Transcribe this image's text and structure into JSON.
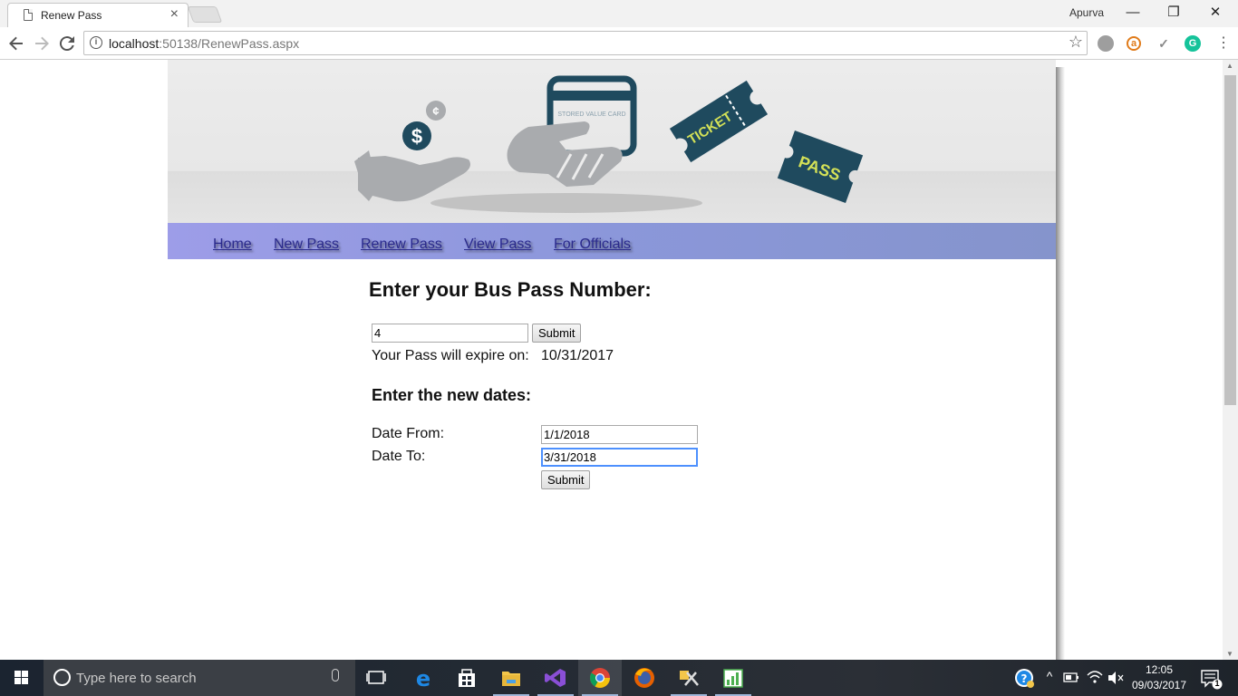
{
  "browser": {
    "tab_title": "Renew Pass",
    "tab_close": "×",
    "user_name": "Apurva",
    "window_controls": {
      "minimize": "—",
      "restore": "❐",
      "close": "✕"
    },
    "url_host": "localhost",
    "url_rest": ":50138/RenewPass.aspx",
    "info_glyph": "i",
    "star_glyph": "☆"
  },
  "banner": {
    "card_text": "STORED VALUE CARD",
    "ticket_text": "TICKET",
    "pass_text": "PASS",
    "dollar": "$",
    "cent": "¢"
  },
  "nav": {
    "items": [
      {
        "label": "Home"
      },
      {
        "label": "New Pass"
      },
      {
        "label": "Renew Pass"
      },
      {
        "label": "View Pass"
      },
      {
        "label": "For Officials"
      }
    ]
  },
  "form": {
    "heading": "Enter your Bus Pass Number:",
    "pass_number": "4",
    "submit_label": "Submit",
    "expire_label": "Your Pass will expire on:",
    "expire_value": "10/31/2017",
    "subheading": "Enter the new dates:",
    "date_from_label": "Date From:",
    "date_from_value": "1/1/2018",
    "date_to_label": "Date To:",
    "date_to_value": "3/31/2018",
    "submit2_label": "Submit"
  },
  "taskbar": {
    "search_placeholder": "Type here to search",
    "time": "12:05",
    "date": "09/03/2017",
    "notification_count": "1"
  },
  "colors": {
    "navbar_start": "#9d9de8",
    "navbar_end": "#8594cc",
    "icon_dark": "#1f4a5e",
    "icon_gray": "#a9abae",
    "ticket_text": "#d4e157"
  }
}
